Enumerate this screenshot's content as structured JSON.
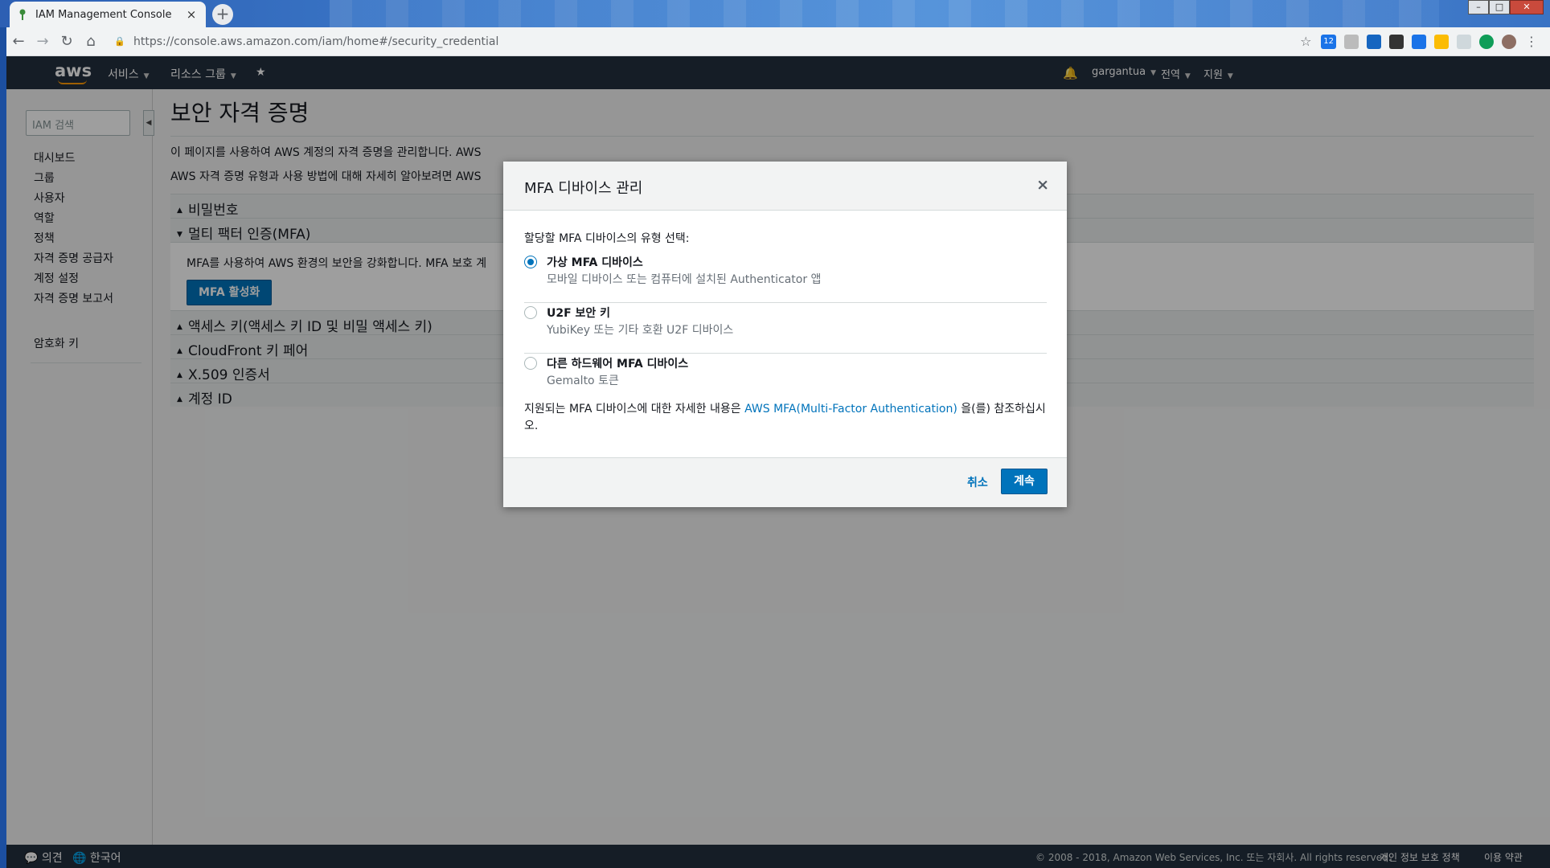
{
  "browser": {
    "tab_title": "IAM Management Console",
    "new_tab_label": "+",
    "url": "https://console.aws.amazon.com/iam/home#/security_credential",
    "ext_badge_count": "12"
  },
  "aws_nav": {
    "logo": "aws",
    "services": "서비스",
    "resource_groups": "리소스 그룹",
    "user": "gargantua",
    "region": "전역",
    "support": "지원"
  },
  "sidebar": {
    "search_placeholder": "IAM 검색",
    "items": [
      {
        "label": "대시보드"
      },
      {
        "label": "그룹"
      },
      {
        "label": "사용자"
      },
      {
        "label": "역할"
      },
      {
        "label": "정책"
      },
      {
        "label": "자격 증명 공급자"
      },
      {
        "label": "계정 설정"
      },
      {
        "label": "자격 증명 보고서"
      }
    ],
    "encryption_keys": "암호화 키"
  },
  "main": {
    "title": "보안 자격 증명",
    "desc1": "이 페이지를 사용하여 AWS 계정의 자격 증명을 관리합니다. AWS",
    "desc2": "AWS 자격 증명 유형과 사용 방법에 대해 자세히 알아보려면 AWS",
    "sections": {
      "password": "비밀번호",
      "mfa": "멀티 팩터 인증(MFA)",
      "access_keys": "액세스 키(액세스 키 ID 및 비밀 액세스 키)",
      "cloudfront": "CloudFront 키 페어",
      "x509": "X.509 인증서",
      "account_id": "계정 ID"
    },
    "mfa_text": "MFA를 사용하여 AWS 환경의 보안을 강화합니다. MFA 보호 계",
    "mfa_button": "MFA 활성화"
  },
  "modal": {
    "title": "MFA 디바이스 관리",
    "close": "×",
    "prompt": "할당할 MFA 디바이스의 유형 선택:",
    "options": [
      {
        "name": "가상 MFA 디바이스",
        "sub": "모바일 디바이스 또는 컴퓨터에 설치된 Authenticator 앱",
        "selected": true
      },
      {
        "name": "U2F 보안 키",
        "sub": "YubiKey 또는 기타 호환 U2F 디바이스",
        "selected": false
      },
      {
        "name": "다른 하드웨어 MFA 디바이스",
        "sub": "Gemalto 토큰",
        "selected": false
      }
    ],
    "note_prefix": "지원되는 MFA 디바이스에 대한 자세한 내용은 ",
    "note_link": "AWS MFA(Multi-Factor Authentication)",
    "note_suffix": " 을(를) 참조하십시오.",
    "cancel": "취소",
    "continue": "계속"
  },
  "footer": {
    "feedback": "의견",
    "language": "한국어",
    "copyright": "© 2008 - 2018, Amazon Web Services, Inc. 또는 자회사. All rights reserved.",
    "privacy": "개인 정보 보호 정책",
    "terms": "이용 약관"
  },
  "colors": {
    "aws_dark": "#232f3e",
    "accent_blue": "#0073bb",
    "aws_orange": "#ff9900"
  }
}
